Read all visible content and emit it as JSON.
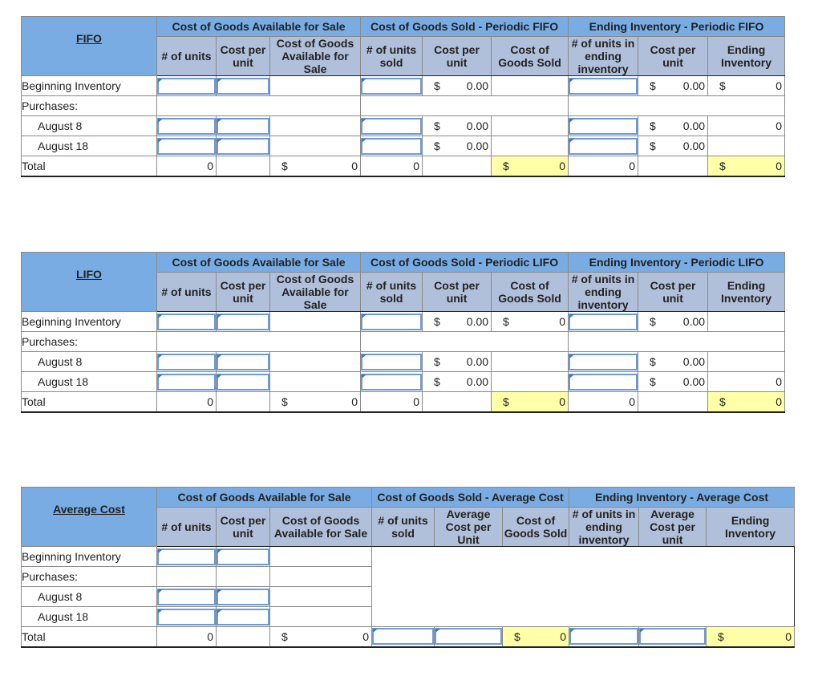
{
  "sections": [
    {
      "title": "FIFO",
      "groups": [
        "Cost of Goods Available for Sale",
        "Cost of Goods Sold - Periodic FIFO",
        "Ending Inventory - Periodic FIFO"
      ],
      "columns": [
        "# of units",
        "Cost per unit",
        "Cost of Goods Available for Sale",
        "# of units sold",
        "Cost per unit",
        "Cost of Goods Sold",
        "# of units in ending inventory",
        "Cost per unit",
        "Ending Inventory"
      ],
      "rows": [
        {
          "label": "Beginning Inventory",
          "cells": [
            "input",
            "input",
            "blank",
            "input",
            {
              "prefix": "$",
              "value": "0.00"
            },
            "blank",
            "input",
            {
              "prefix": "$",
              "value": "0.00"
            },
            {
              "prefix": "$",
              "value": "0"
            }
          ]
        },
        {
          "label": "Purchases:",
          "cells": []
        },
        {
          "label": "August 8",
          "indent": true,
          "cells": [
            "input",
            "input",
            "blank",
            "input",
            {
              "prefix": "$",
              "value": "0.00"
            },
            "blank",
            "input",
            {
              "prefix": "$",
              "value": "0.00"
            },
            {
              "prefix": "",
              "value": "0"
            }
          ]
        },
        {
          "label": "August 18",
          "indent": true,
          "cells": [
            "input",
            "input",
            "blank",
            "input",
            {
              "prefix": "$",
              "value": "0.00"
            },
            "blank",
            "input",
            {
              "prefix": "$",
              "value": "0.00"
            },
            "blank"
          ]
        },
        {
          "label": "Total",
          "total": true,
          "cells": [
            {
              "prefix": "",
              "value": "0"
            },
            "blank",
            {
              "prefix": "$",
              "value": "0"
            },
            {
              "prefix": "",
              "value": "0"
            },
            "blank",
            {
              "prefix": "$",
              "value": "0",
              "highlight": true
            },
            {
              "prefix": "",
              "value": "0"
            },
            "blank",
            {
              "prefix": "$",
              "value": "0",
              "highlight": true
            }
          ]
        }
      ]
    },
    {
      "title": "LIFO",
      "groups": [
        "Cost of Goods Available for Sale",
        "Cost of Goods Sold - Periodic LIFO",
        "Ending Inventory - Periodic LIFO"
      ],
      "columns": [
        "# of units",
        "Cost per unit",
        "Cost of Goods Available for Sale",
        "# of units sold",
        "Cost per unit",
        "Cost of Goods Sold",
        "# of units in ending inventory",
        "Cost per unit",
        "Ending Inventory"
      ],
      "rows": [
        {
          "label": "Beginning Inventory",
          "cells": [
            "input",
            "input",
            "blank",
            "input",
            {
              "prefix": "$",
              "value": "0.00"
            },
            {
              "prefix": "$",
              "value": "0"
            },
            "input",
            {
              "prefix": "$",
              "value": "0.00"
            },
            "blank"
          ]
        },
        {
          "label": "Purchases:",
          "cells": []
        },
        {
          "label": "August 8",
          "indent": true,
          "cells": [
            "input",
            "input",
            "blank",
            "input",
            {
              "prefix": "$",
              "value": "0.00"
            },
            "blank",
            "input",
            {
              "prefix": "$",
              "value": "0.00"
            },
            "blank"
          ]
        },
        {
          "label": "August 18",
          "indent": true,
          "cells": [
            "input",
            "input",
            "blank",
            "input",
            {
              "prefix": "$",
              "value": "0.00"
            },
            "blank",
            "input",
            {
              "prefix": "$",
              "value": "0.00"
            },
            {
              "prefix": "",
              "value": "0"
            }
          ]
        },
        {
          "label": "Total",
          "total": true,
          "cells": [
            {
              "prefix": "",
              "value": "0"
            },
            "blank",
            {
              "prefix": "$",
              "value": "0"
            },
            {
              "prefix": "",
              "value": "0"
            },
            "blank",
            {
              "prefix": "$",
              "value": "0",
              "highlight": true
            },
            {
              "prefix": "",
              "value": "0"
            },
            "blank",
            {
              "prefix": "$",
              "value": "0",
              "highlight": true
            }
          ]
        }
      ]
    },
    {
      "title": "Average Cost",
      "groups": [
        "Cost of Goods Available for Sale",
        "Cost of Goods Sold - Average Cost",
        "Ending Inventory - Average Cost"
      ],
      "columns": [
        "# of units",
        "Cost per unit",
        "Cost of Goods Available for Sale",
        "# of units sold",
        "Average Cost per Unit",
        "Cost of Goods Sold",
        "# of units in ending inventory",
        "Average Cost per unit",
        "Ending Inventory"
      ],
      "rows": [
        {
          "label": "Beginning Inventory",
          "cells": [
            "input",
            "input",
            "blank"
          ]
        },
        {
          "label": "Purchases:",
          "cells": [
            "blank",
            "blank",
            "blank"
          ]
        },
        {
          "label": "August 8",
          "indent": true,
          "cells": [
            "input",
            "input",
            "blank"
          ]
        },
        {
          "label": "August 18",
          "indent": true,
          "cells": [
            "input",
            "input",
            "blank"
          ]
        },
        {
          "label": "Total",
          "total": true,
          "cells": [
            {
              "prefix": "",
              "value": "0"
            },
            "blank",
            {
              "prefix": "$",
              "value": "0"
            },
            "input",
            "input",
            {
              "prefix": "$",
              "value": "0",
              "highlight": true
            },
            "input",
            "input",
            {
              "prefix": "$",
              "value": "0",
              "highlight": true
            }
          ]
        }
      ]
    }
  ],
  "colors": {
    "group_header": "#78ace3",
    "column_header": "#b0bfda",
    "highlight": "#ffffa8",
    "input_border": "#6e9bd6"
  }
}
